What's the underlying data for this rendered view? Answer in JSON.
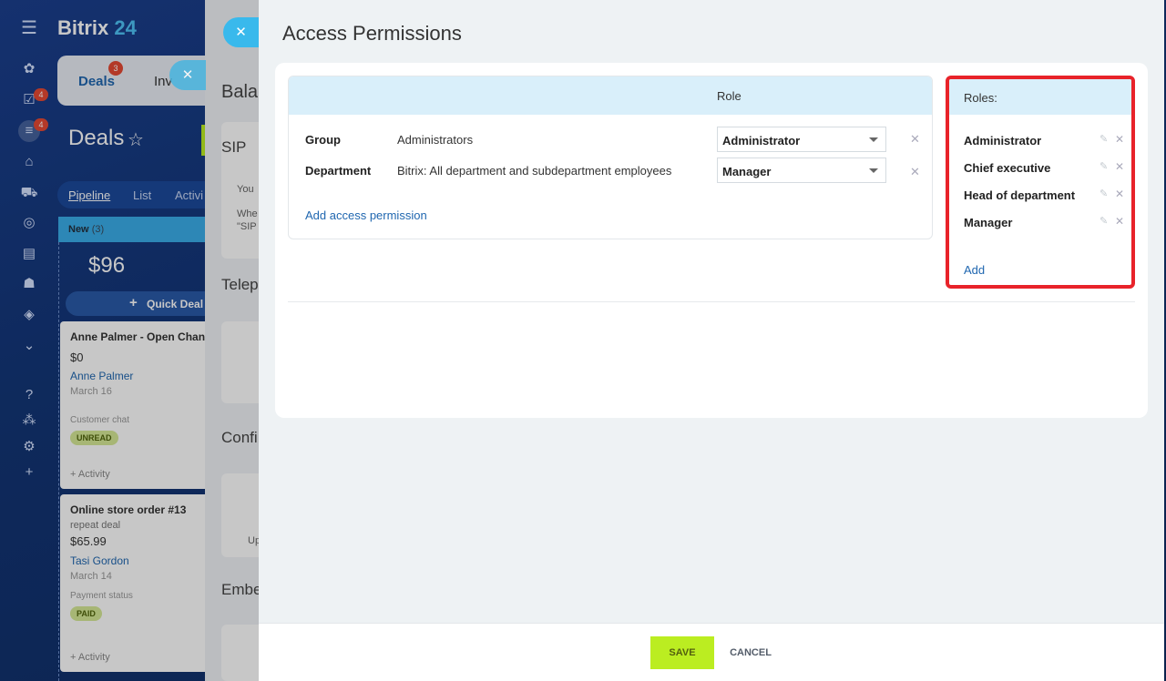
{
  "app": {
    "brand_name": "Bitrix",
    "brand_num": "24",
    "tabs": {
      "deals": "Deals",
      "deals_badge": "3",
      "inv": "Inv"
    },
    "rail_badges": {
      "tasks": "4",
      "crm": "4"
    },
    "page_title": "Deals",
    "view_tabs": {
      "pipeline": "Pipeline",
      "list": "List",
      "activities": "Activi"
    },
    "kanban": {
      "stage": "New",
      "stage_count": "(3)",
      "sum": "$96",
      "quick_deal": "Quick Deal",
      "cards": [
        {
          "title": "Anne Palmer - Open Chan",
          "amount": "$0",
          "contact": "Anne Palmer",
          "date": "March 16",
          "label": "Customer chat",
          "badge": "UNREAD",
          "activity": "+ Activity"
        },
        {
          "title": "Online store order #13",
          "subtitle": "repeat deal",
          "amount": "$65.99",
          "contact": "Tasi Gordon",
          "date": "March 14",
          "label": "Payment status",
          "badge": "PAID",
          "activity": "+ Activity"
        }
      ]
    },
    "middle_panel": {
      "heading": "Bala",
      "box1_title": "SIP",
      "box1_line1": "You",
      "box1_line2": "Whe",
      "box1_line3": "\"SIP",
      "section2": "Telep",
      "section3": "Confi",
      "box3_text": "Up",
      "section4": "Embe"
    }
  },
  "slider": {
    "title": "Access Permissions",
    "permissions": {
      "role_header": "Role",
      "rows": [
        {
          "type": "Group",
          "name": "Administrators",
          "role": "Administrator"
        },
        {
          "type": "Department",
          "name": "Bitrix: All department and subdepartment employees",
          "role": "Manager"
        }
      ],
      "add_label": "Add access permission"
    },
    "roles": {
      "header": "Roles:",
      "items": [
        "Administrator",
        "Chief executive",
        "Head of department",
        "Manager"
      ],
      "add_label": "Add"
    },
    "footer": {
      "save": "SAVE",
      "cancel": "CANCEL"
    }
  },
  "colors": {
    "accent_green": "#bbed21",
    "link_blue": "#2067b0",
    "highlight_red": "#e8232a",
    "header_blue": "#d9effa"
  },
  "icons": {
    "close": "close-icon",
    "edit": "pencil-icon",
    "delete": "delete-x-icon"
  }
}
